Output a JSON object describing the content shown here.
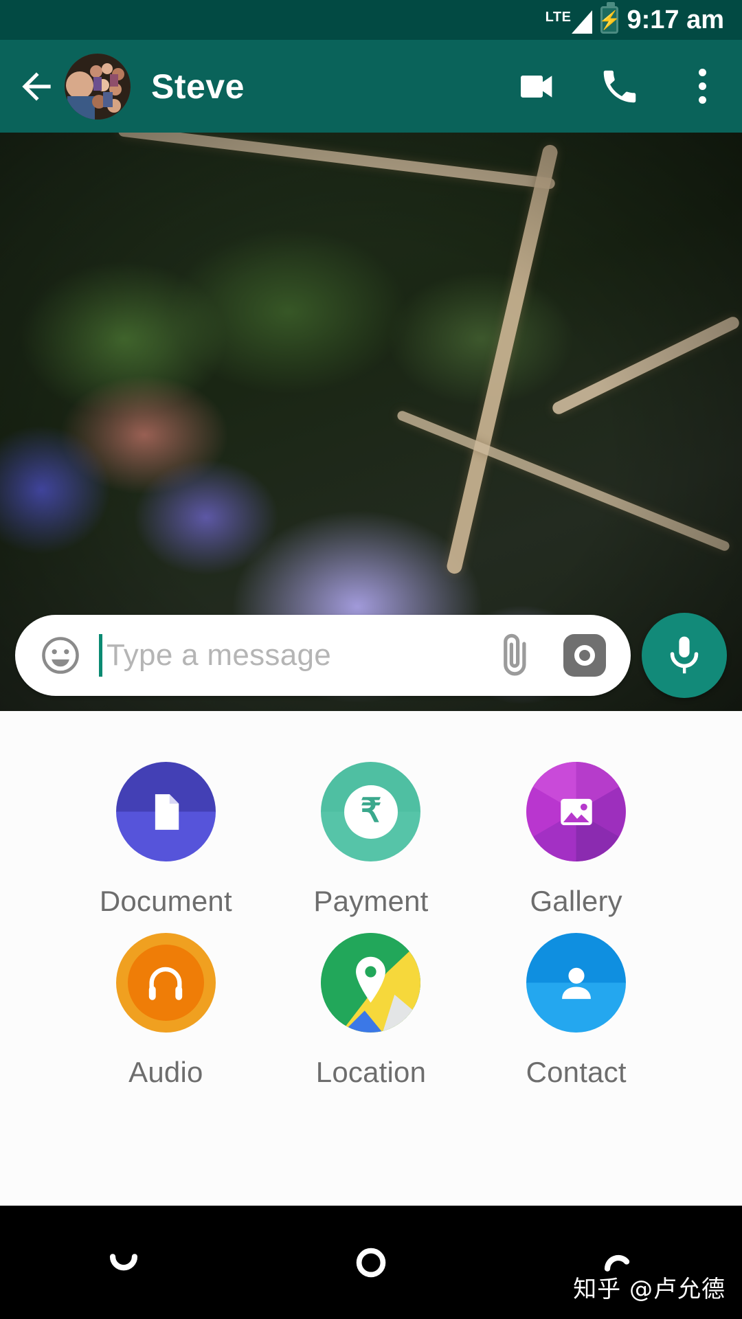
{
  "status_bar": {
    "network_label": "LTE",
    "time": "9:17 am",
    "battery_icon": "battery-charging-icon",
    "signal_icon": "signal-bars-icon"
  },
  "app_bar": {
    "back_icon": "back-arrow-icon",
    "avatar_name": "contact-avatar",
    "title": "Steve",
    "actions": [
      {
        "name": "video-call-button",
        "icon": "video-camera-icon"
      },
      {
        "name": "voice-call-button",
        "icon": "phone-icon"
      },
      {
        "name": "more-options-button",
        "icon": "overflow-menu-icon"
      }
    ]
  },
  "composer": {
    "emoji_icon": "emoji-smiley-icon",
    "placeholder": "Type a message",
    "value": "",
    "attach_icon": "paperclip-icon",
    "camera_icon": "camera-icon",
    "mic_icon": "microphone-icon"
  },
  "attachment_sheet": {
    "items": [
      {
        "label": "Document",
        "icon": "document-icon",
        "color": "#4f4cd0"
      },
      {
        "label": "Payment",
        "icon": "rupee-icon",
        "color": "#4fbfa2",
        "symbol": "₹"
      },
      {
        "label": "Gallery",
        "icon": "image-icon",
        "color": "#c13fd0"
      },
      {
        "label": "Audio",
        "icon": "headphones-icon",
        "color": "#f0a020"
      },
      {
        "label": "Location",
        "icon": "map-pin-icon",
        "color": "#22a75a"
      },
      {
        "label": "Contact",
        "icon": "person-icon",
        "color": "#0f8fe0"
      }
    ]
  },
  "nav_bar": {
    "back": "nav-back-icon",
    "home": "nav-home-icon",
    "recents": "nav-recents-icon"
  },
  "watermark": {
    "text": "知乎 @卢允德"
  },
  "colors": {
    "status_bar": "#024a43",
    "app_bar": "#0a635a",
    "mic_button": "#128a79",
    "sheet_bg": "#fcfcfc",
    "label_text": "#6d6d6d",
    "placeholder_text": "#b5b5b5"
  }
}
